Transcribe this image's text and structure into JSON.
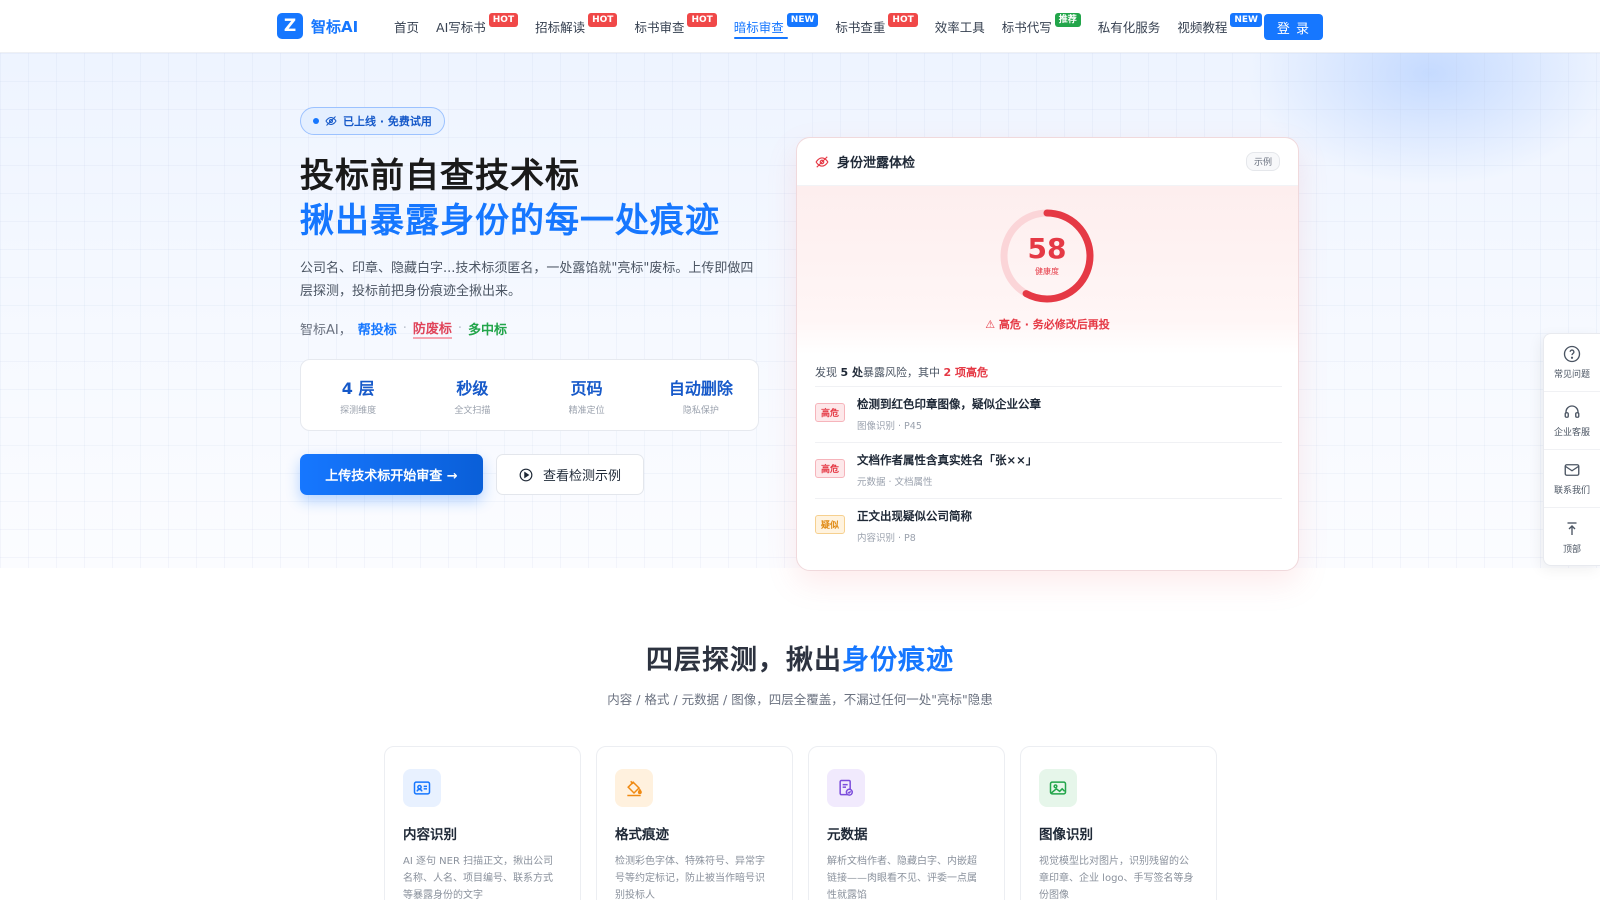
{
  "brand": {
    "logo_letter": "Z",
    "name": "智标AI"
  },
  "nav": {
    "items": [
      {
        "label": "首页",
        "badge": ""
      },
      {
        "label": "AI写标书",
        "badge": "HOT"
      },
      {
        "label": "招标解读",
        "badge": "HOT"
      },
      {
        "label": "标书审查",
        "badge": "HOT"
      },
      {
        "label": "暗标审查",
        "badge": "NEW"
      },
      {
        "label": "标书查重",
        "badge": "HOT"
      },
      {
        "label": "效率工具",
        "badge": ""
      },
      {
        "label": "标书代写",
        "badge": "推荐"
      },
      {
        "label": "私有化服务",
        "badge": ""
      },
      {
        "label": "视频教程",
        "badge": "NEW"
      }
    ],
    "login_label": "登 录"
  },
  "hero": {
    "pill": "已上线 · 免费试用",
    "title_line1": "投标前自查技术标",
    "title_line2": "揪出暴露身份的每一处痕迹",
    "desc": "公司名、印章、隐藏白字...技术标须匿名，一处露馅就\"亮标\"废标。上传即做四层探测，投标前把身份痕迹全揪出来。",
    "tagline_prefix": "智标AI，",
    "tagline_1": "帮投标",
    "tagline_2": "防废标",
    "tagline_3": "多中标",
    "tagline_sep": "·",
    "stats": [
      {
        "value": "4 层",
        "label": "探测维度"
      },
      {
        "value": "秒级",
        "label": "全文扫描"
      },
      {
        "value": "页码",
        "label": "精准定位"
      },
      {
        "value": "自动删除",
        "label": "隐私保护"
      }
    ],
    "primary_button": "上传技术标开始审查 →",
    "secondary_button": "查看检测示例"
  },
  "report": {
    "title": "身份泄露体检",
    "tag": "示例",
    "score": "58",
    "score_label": "健康度",
    "score_fraction": 0.58,
    "warning": "⚠ 高危 · 务必修改后再投",
    "summary_prefix": "发现",
    "summary_count": "5 处",
    "summary_mid": "暴露风险，其中",
    "summary_high": "2 项高危",
    "risks": [
      {
        "level": "高危",
        "title": "检测到红色印章图像，疑似企业公章",
        "meta": "图像识别 · P45"
      },
      {
        "level": "高危",
        "title": "文档作者属性含真实姓名「张××」",
        "meta": "元数据 · 文档属性"
      },
      {
        "level": "疑似",
        "title": "正文出现疑似公司简称",
        "meta": "内容识别 · P8"
      }
    ]
  },
  "dock": [
    {
      "label": "常见问题",
      "icon": "help-icon"
    },
    {
      "label": "企业客服",
      "icon": "headset-icon"
    },
    {
      "label": "联系我们",
      "icon": "mail-icon"
    },
    {
      "label": "顶部",
      "icon": "back-to-top-icon"
    }
  ],
  "section2": {
    "title_prefix": "四层探测，揪出",
    "title_highlight": "身份痕迹",
    "subtitle": "内容 / 格式 / 元数据 / 图像，四层全覆盖，不漏过任何一处\"亮标\"隐患",
    "features": [
      {
        "title": "内容识别",
        "desc": "AI 逐句 NER 扫描正文，揪出公司名称、人名、项目编号、联系方式等暴露身份的文字",
        "icon": "id-card-icon",
        "color": "#1677ff"
      },
      {
        "title": "格式痕迹",
        "desc": "检测彩色字体、特殊符号、异常字号等约定标记，防止被当作暗号识别投标人",
        "icon": "paint-bucket-icon",
        "color": "#f08a12"
      },
      {
        "title": "元数据",
        "desc": "解析文档作者、隐藏白字、内嵌超链接——肉眼看不见、评委一点属性就露馅",
        "icon": "document-check-icon",
        "color": "#7c4ddb"
      },
      {
        "title": "图像识别",
        "desc": "视觉模型比对图片，识别残留的公章印章、企业 logo、手写签名等身份图像",
        "icon": "image-icon",
        "color": "#22a54a"
      }
    ]
  }
}
